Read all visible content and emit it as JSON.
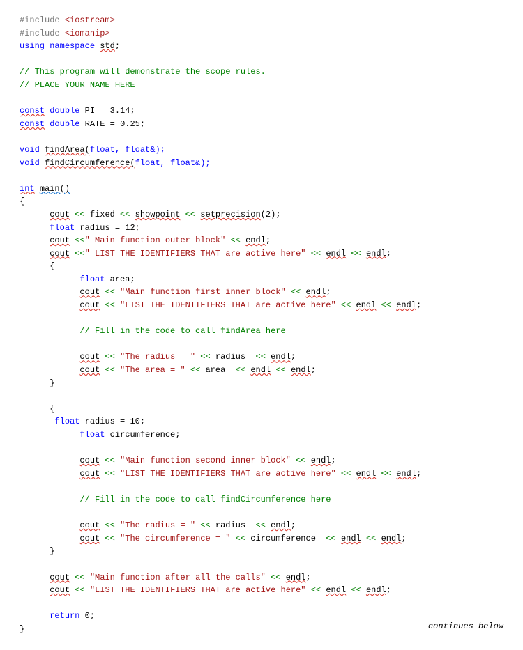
{
  "code": {
    "line1_preproc": "#include",
    "line1_include": "<iostream>",
    "line2_preproc": "#include",
    "line2_include": "<iomanip>",
    "line3_using": "using",
    "line3_namespace": "namespace",
    "line3_std": "std",
    "comment_program": "// This program will demonstrate the scope rules.",
    "comment_name": "// PLACE YOUR NAME HERE",
    "const1_const": "const",
    "const1_type": "double",
    "const1_id": "PI",
    "const1_eq": " = ",
    "const1_val": "3.14;",
    "const2_const": "const",
    "const2_type": "double",
    "const2_id": "RATE",
    "const2_eq": " = ",
    "const2_val": "0.25;",
    "proto1_void": "void",
    "proto1_name": "findArea(",
    "proto1_params": "float, float&);",
    "proto2_void": "void",
    "proto2_name": "findCircumference(",
    "proto2_params": "float, float&);",
    "main_int": "int",
    "main_name": "main()",
    "brace_open": "{",
    "brace_close": "}",
    "l_cout": "cout",
    "l_fixed": "fixed",
    "l_showpoint": "showpoint",
    "l_setprecision": "setprecision",
    "l_setprecision_arg": "(2);",
    "l_radius_decl_float": "float",
    "l_radius_decl_rest": " radius = 12;",
    "s_main_outer": "\" Main function outer block\"",
    "l_endl": "endl",
    "semicolon": ";",
    "s_list_ids": "\" LIST THE IDENTIFIERS THAT are active here\"",
    "l_area_float": "float",
    "l_area_rest": " area;",
    "s_first_inner": "\"Main function first inner block\"",
    "s_list_ids2": "\"LIST THE IDENTIFIERS THAT are active here\"",
    "comment_findarea": "// Fill in the code to call findArea here",
    "s_the_radius": "\"The radius = \"",
    "l_radius_id": " radius ",
    "s_the_area": "\"The area = \"",
    "l_area_id": " area ",
    "l_radius10_float": "float",
    "l_radius10_rest": " radius = 10;",
    "l_circ_float": "float",
    "l_circ_rest": " circumference;",
    "s_second_inner": "\"Main function second inner block\"",
    "comment_findcirc": "// Fill in the code to call findCircumference here",
    "s_the_circ": "\"The circumference = \"",
    "l_circ_id": " circumference ",
    "s_after_calls": "\"Main function after all the calls\"",
    "l_return": "return",
    "l_return_val": " 0;",
    "op_ins": " << ",
    "op_ins_lead": " <<",
    "footer": "continues below"
  }
}
